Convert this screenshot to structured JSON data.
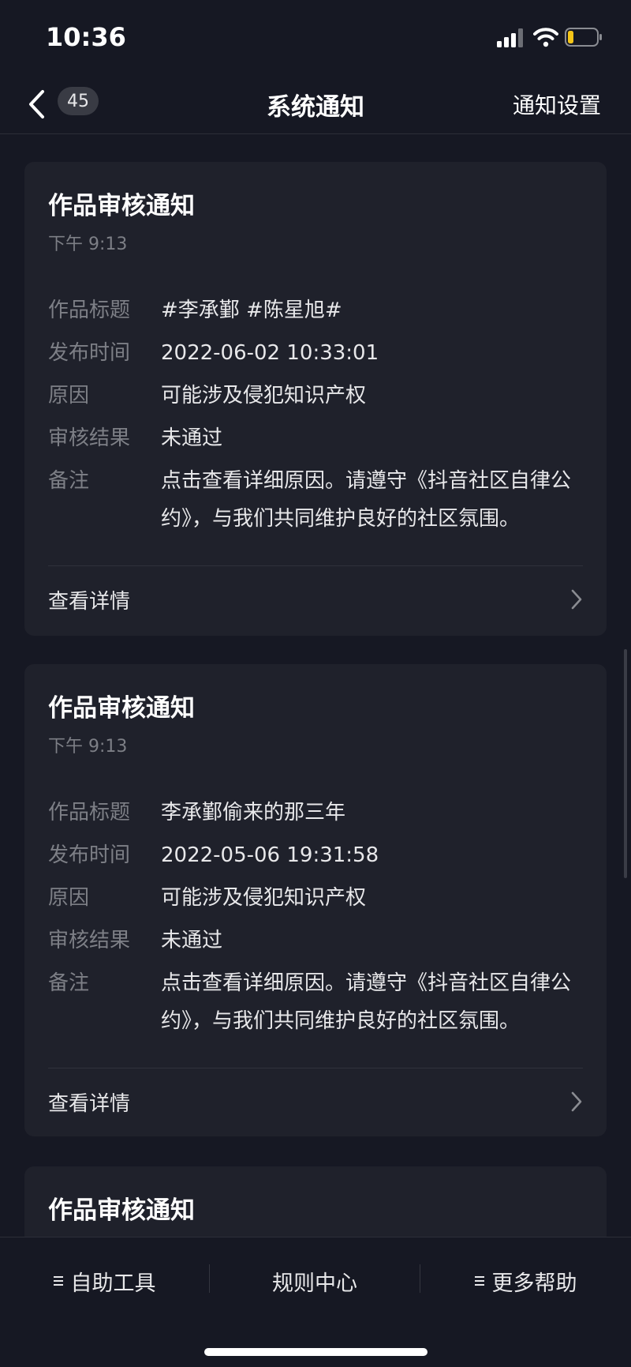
{
  "status_bar": {
    "time": "10:36"
  },
  "nav": {
    "count": "45",
    "title": "系统通知",
    "settings_label": "通知设置"
  },
  "cards": [
    {
      "title": "作品审核通知",
      "time": "下午 9:13",
      "fields": [
        {
          "label": "作品标题",
          "value": "#李承鄞 #陈星旭#"
        },
        {
          "label": "发布时间",
          "value": "2022-06-02 10:33:01"
        },
        {
          "label": "原因",
          "value": "可能涉及侵犯知识产权"
        },
        {
          "label": "审核结果",
          "value": "未通过"
        },
        {
          "label": "备注",
          "value": "点击查看详细原因。请遵守《抖音社区自律公约》，与我们共同维护良好的社区氛围。"
        }
      ],
      "detail_label": "查看详情"
    },
    {
      "title": "作品审核通知",
      "time": "下午 9:13",
      "fields": [
        {
          "label": "作品标题",
          "value": "李承鄞偷来的那三年"
        },
        {
          "label": "发布时间",
          "value": "2022-05-06 19:31:58"
        },
        {
          "label": "原因",
          "value": "可能涉及侵犯知识产权"
        },
        {
          "label": "审核结果",
          "value": "未通过"
        },
        {
          "label": "备注",
          "value": "点击查看详细原因。请遵守《抖音社区自律公约》，与我们共同维护良好的社区氛围。"
        }
      ],
      "detail_label": "查看详情"
    },
    {
      "title": "作品审核通知"
    }
  ],
  "bottom_bar": {
    "self_help": "自助工具",
    "rules_center": "规则中心",
    "more_help": "更多帮助"
  },
  "icons": [
    "signal-icon",
    "wifi-icon",
    "battery-icon",
    "chevron-left-icon",
    "chevron-right-icon",
    "menu-icon"
  ],
  "colors": {
    "background": "#161823",
    "card": "#1f212b",
    "battery_level": "#f5c518",
    "muted_text": "#7d7f86"
  }
}
